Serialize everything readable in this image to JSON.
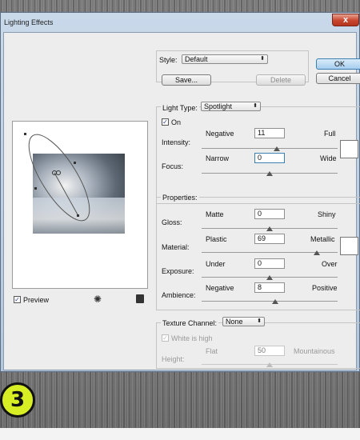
{
  "window": {
    "title": "Lighting Effects",
    "close_glyph": "x"
  },
  "style": {
    "label": "Style:",
    "value": "Default",
    "save": "Save...",
    "delete": "Delete"
  },
  "actions": {
    "ok": "OK",
    "cancel": "Cancel"
  },
  "light": {
    "type_label": "Light Type:",
    "type_value": "Spotlight",
    "on_label": "On",
    "on_checked": true,
    "intensity": {
      "label": "Intensity:",
      "low": "Negative",
      "high": "Full",
      "value": "11",
      "level": 0.55
    },
    "focus": {
      "label": "Focus:",
      "low": "Narrow",
      "high": "Wide",
      "value": "0",
      "level": 0.5
    },
    "swatch_color": "#ffffff"
  },
  "properties": {
    "title": "Properties:",
    "gloss": {
      "label": "Gloss:",
      "low": "Matte",
      "high": "Shiny",
      "value": "0",
      "level": 0.5
    },
    "material": {
      "label": "Material:",
      "low": "Plastic",
      "high": "Metallic",
      "value": "69",
      "level": 0.85
    },
    "exposure": {
      "label": "Exposure:",
      "low": "Under",
      "high": "Over",
      "value": "0",
      "level": 0.5
    },
    "ambience": {
      "label": "Ambience:",
      "low": "Negative",
      "high": "Positive",
      "value": "8",
      "level": 0.54
    },
    "swatch_color": "#ffffff"
  },
  "texture": {
    "channel_label": "Texture Channel:",
    "channel_value": "None",
    "white_is_high": "White is high",
    "height": {
      "label": "Height:",
      "low": "Flat",
      "high": "Mountainous",
      "value": "50",
      "level": 0.5
    }
  },
  "preview": {
    "label": "Preview",
    "checked": true
  },
  "icons": {
    "bulb": "light-bulb-icon",
    "trash": "trash-icon"
  },
  "branding": {
    "logo_text": "3",
    "logo_color": "#d8ee24"
  }
}
